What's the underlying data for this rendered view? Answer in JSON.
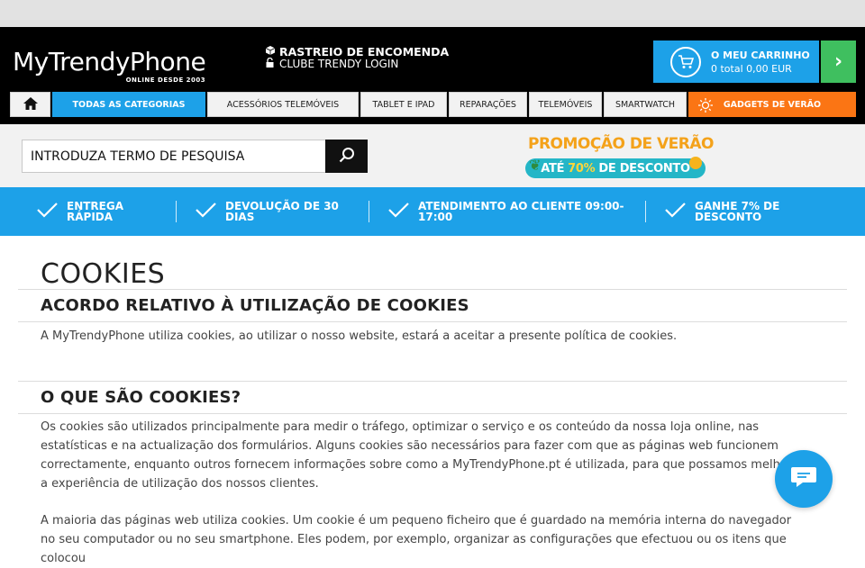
{
  "brand": {
    "logo_text": "MyTrendyPhone",
    "logo_tagline": "ONLINE DESDE 2003",
    "colors": {
      "primary_blue": "#1da1e8",
      "orange": "#fb7514",
      "green": "#3fbf5f",
      "header_bg": "#000000"
    }
  },
  "top_links": [
    {
      "label": "RASTREIO DE ENCOMENDA",
      "icon": "box-icon"
    },
    {
      "label": "CLUBE TRENDY LOGIN",
      "icon": "lock-icon"
    }
  ],
  "cart": {
    "title": "O MEU CARRINHO",
    "summary": "0 total 0,00 EUR",
    "icon": "cart-icon"
  },
  "nav": {
    "home_icon": "home-icon",
    "items": [
      "TODAS AS CATEGORIAS",
      "ACESSÓRIOS TELEMÓVEIS",
      "TABLET E IPAD",
      "REPARAÇÕES",
      "TELEMÓVEIS",
      "SMARTWATCH",
      "GADGETS DE VERÃO"
    ]
  },
  "search": {
    "placeholder": "INTRODUZA TERMO DE PESQUISA",
    "icon": "search-icon"
  },
  "promo": {
    "line1": "PROMOÇÃO DE VERÃO",
    "line2_pre": "ATÉ",
    "line2_highlight": "70%",
    "line2_post": "DE DESCONTO"
  },
  "usp": [
    {
      "text": "ENTREGA RÁPIDA",
      "icon": "check-icon"
    },
    {
      "text": "DEVOLUÇÃO DE 30 DIAS",
      "icon": "check-icon"
    },
    {
      "text": "ATENDIMENTO AO CLIENTE 09:00-17:00",
      "icon": "check-icon"
    },
    {
      "text": "GANHE 7% DE DESCONTO",
      "icon": "check-icon"
    }
  ],
  "page": {
    "title": "COOKIES",
    "sections": [
      {
        "heading": "ACORDO RELATIVO À UTILIZAÇÃO DE COOKIES",
        "paragraphs": [
          "A MyTrendyPhone utiliza cookies, ao utilizar o nosso website, estará a aceitar a presente política de cookies."
        ]
      },
      {
        "heading": "O QUE SÃO COOKIES?",
        "paragraphs": [
          "Os cookies são utilizados principalmente para medir o tráfego, optimizar o serviço e os conteúdo da nossa loja online, nas estatísticas e na actualização dos formulários. Alguns cookies são necessários para fazer com que as páginas web funcionem correctamente, enquanto outros fornecem informações sobre como a MyTrendyPhone.pt é utilizada, para que possamos melhorar a experiência de utilização dos nossos clientes.",
          "A maioria das páginas web utiliza cookies. Um cookie é um pequeno ficheiro que é guardado na memória interna do navegador no seu computador ou no seu smartphone. Eles podem, por exemplo, organizar as configurações que efectuou ou os itens que colocou"
        ]
      }
    ]
  },
  "chat": {
    "icon": "chat-icon"
  }
}
